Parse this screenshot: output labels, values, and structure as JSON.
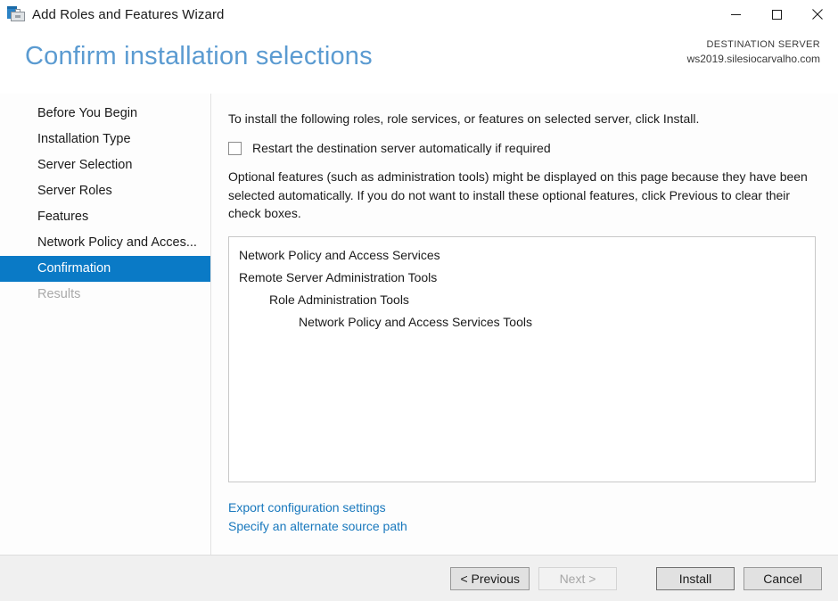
{
  "window": {
    "title": "Add Roles and Features Wizard",
    "icon": "wizard-toolbox-icon",
    "controls": {
      "minimize": "minimize-icon",
      "maximize": "maximize-icon",
      "close": "close-icon"
    }
  },
  "header": {
    "page_title": "Confirm installation selections",
    "destination_label": "DESTINATION SERVER",
    "destination_value": "ws2019.silesiocarvalho.com",
    "title_color": "#5b9bd1"
  },
  "sidebar": {
    "items": [
      {
        "label": "Before You Begin",
        "state": "normal"
      },
      {
        "label": "Installation Type",
        "state": "normal"
      },
      {
        "label": "Server Selection",
        "state": "normal"
      },
      {
        "label": "Server Roles",
        "state": "normal"
      },
      {
        "label": "Features",
        "state": "normal"
      },
      {
        "label": "Network Policy and Acces...",
        "state": "normal"
      },
      {
        "label": "Confirmation",
        "state": "selected"
      },
      {
        "label": "Results",
        "state": "disabled"
      }
    ],
    "selected_color": "#0a7ac6"
  },
  "main": {
    "intro_text": "To install the following roles, role services, or features on selected server, click Install.",
    "restart_checkbox": {
      "label": "Restart the destination server automatically if required",
      "checked": false
    },
    "optional_text": "Optional features (such as administration tools) might be displayed on this page because they have been selected automatically. If you do not want to install these optional features, click Previous to clear their check boxes.",
    "selections": [
      {
        "label": "Network Policy and Access Services",
        "indent": 0
      },
      {
        "label": "Remote Server Administration Tools",
        "indent": 0
      },
      {
        "label": "Role Administration Tools",
        "indent": 1
      },
      {
        "label": "Network Policy and Access Services Tools",
        "indent": 2
      }
    ],
    "links": [
      {
        "label": "Export configuration settings"
      },
      {
        "label": "Specify an alternate source path"
      }
    ],
    "link_color": "#1878bd"
  },
  "footer": {
    "buttons": [
      {
        "label": "< Previous",
        "state": "enabled"
      },
      {
        "label": "Next >",
        "state": "disabled"
      },
      {
        "label": "Install",
        "state": "default"
      },
      {
        "label": "Cancel",
        "state": "enabled"
      }
    ]
  }
}
